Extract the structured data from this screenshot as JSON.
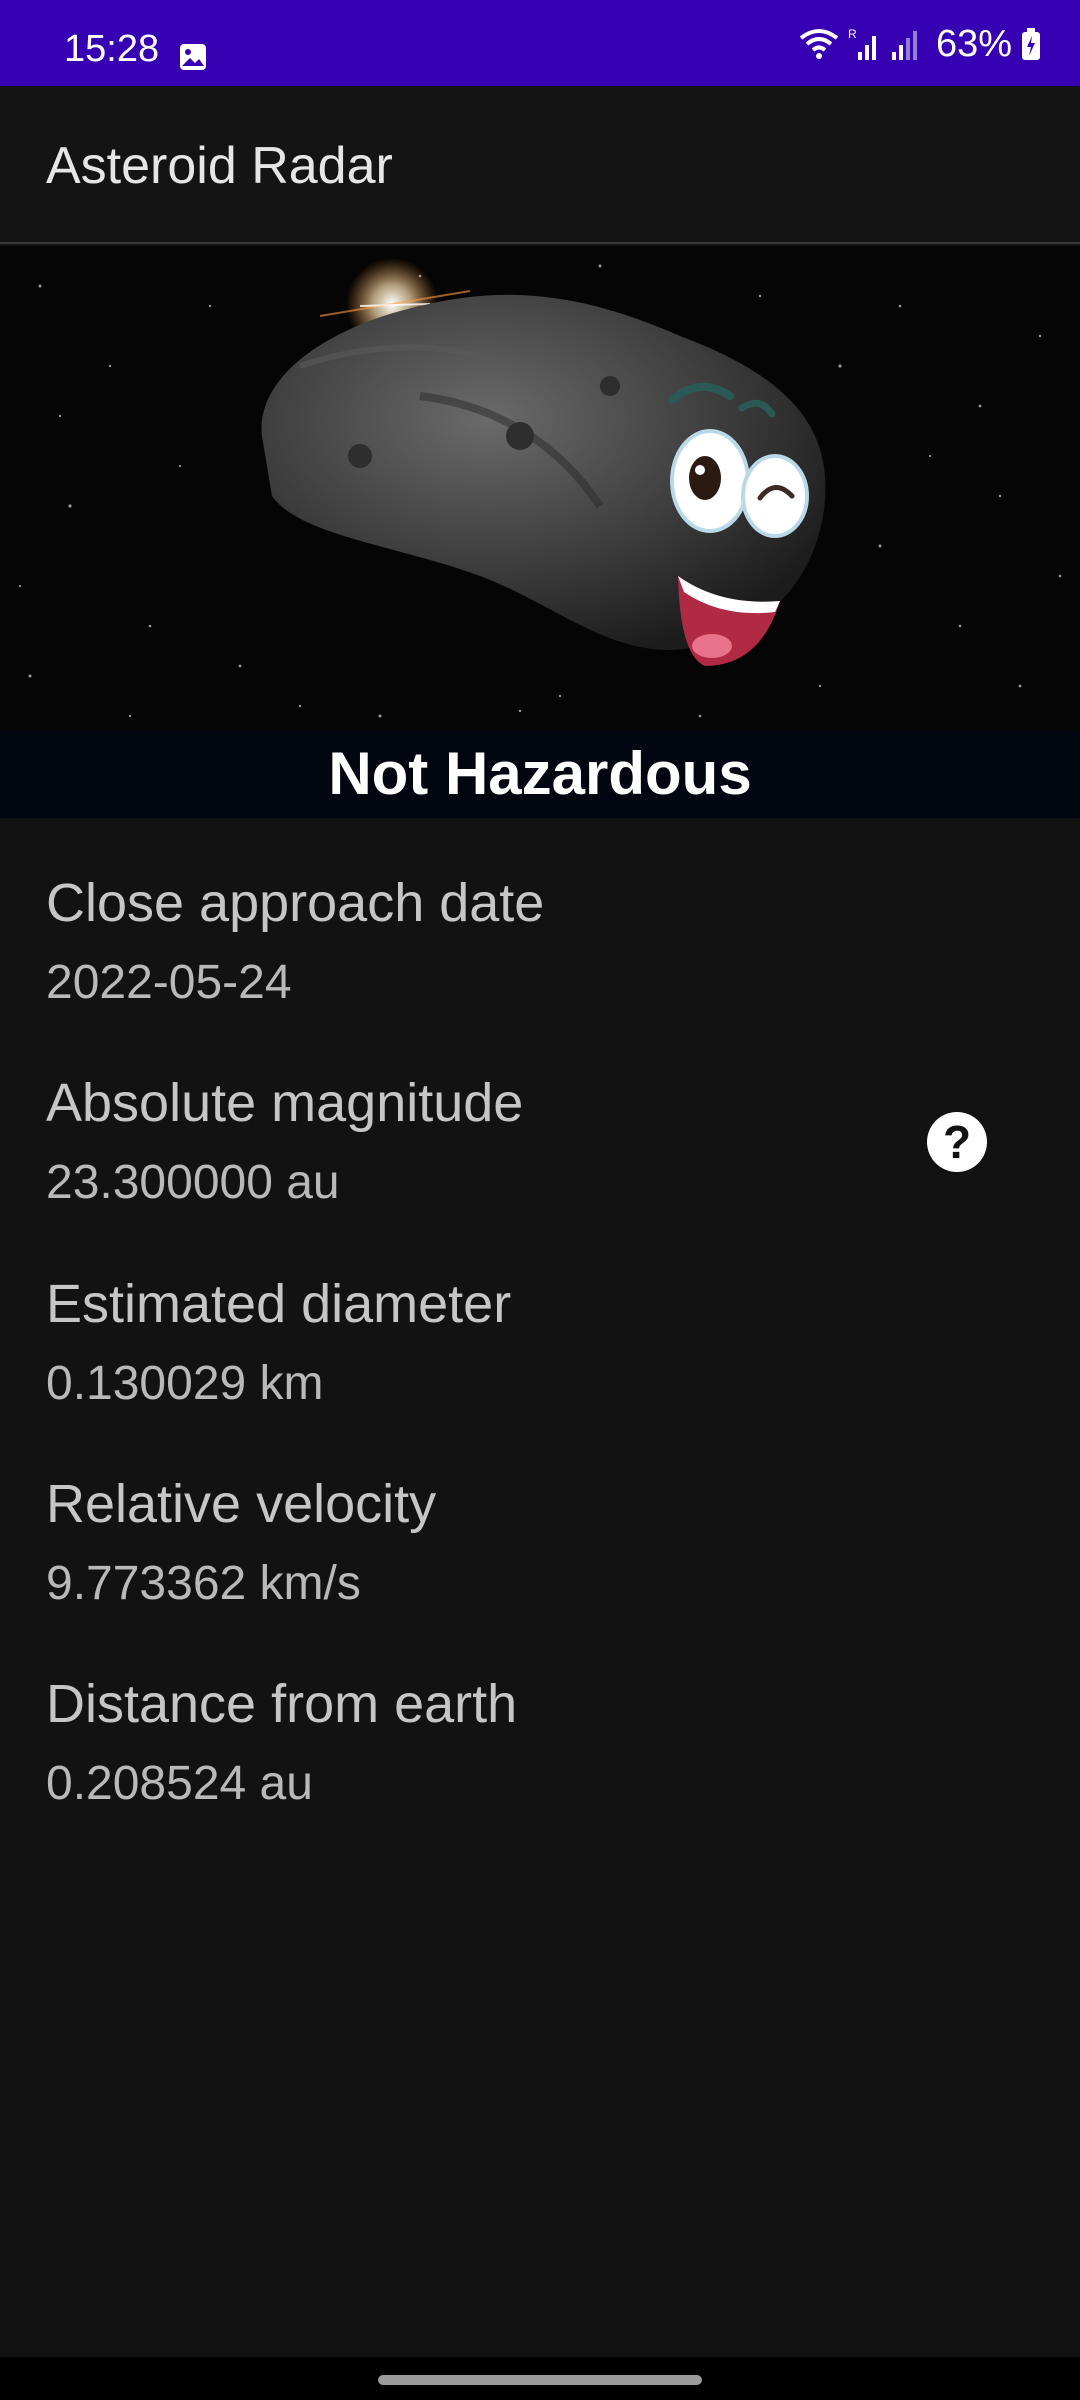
{
  "status_bar": {
    "time": "15:28",
    "battery": "63%",
    "icons": [
      "gallery-icon",
      "wifi-icon",
      "signal-icon",
      "signal-icon",
      "battery-icon"
    ]
  },
  "app_bar": {
    "title": "Asteroid Radar"
  },
  "hero": {
    "banner_text": "Not Hazardous"
  },
  "details": [
    {
      "label": "Close approach date",
      "value": "2022-05-24"
    },
    {
      "label": "Absolute magnitude",
      "value": "23.300000 au"
    },
    {
      "label": "Estimated diameter",
      "value": "0.130029 km"
    },
    {
      "label": "Relative velocity",
      "value": "9.773362 km/s"
    },
    {
      "label": "Distance from earth",
      "value": "0.208524 au"
    }
  ],
  "help": {
    "icon": "help-icon",
    "glyph": "?"
  },
  "colors": {
    "status_bar": "#3700b3",
    "background": "#121212",
    "banner": "#020611"
  }
}
